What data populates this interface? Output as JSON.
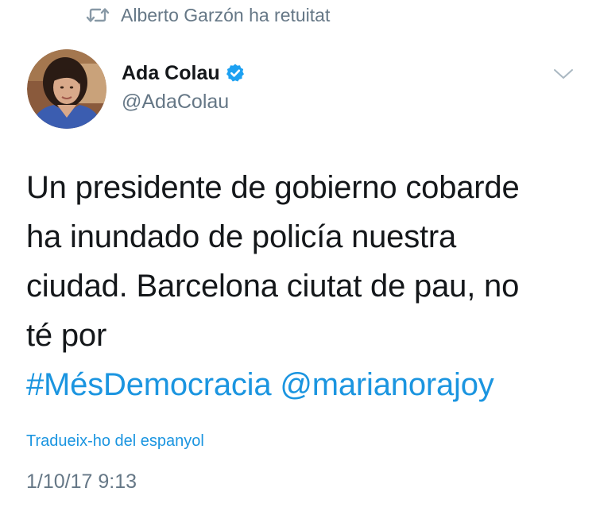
{
  "retweet": {
    "icon": "retweet-icon",
    "text": "Alberto Garzón ha retuitat"
  },
  "author": {
    "avatar": "avatar",
    "name": "Ada Colau",
    "verified_icon": "verified-badge-icon",
    "handle": "@AdaColau"
  },
  "menu": {
    "icon": "chevron-down-icon"
  },
  "tweet": {
    "lines": [
      "Un presidente de gobierno cobarde",
      "ha inundado de policía nuestra",
      "ciudad. Barcelona ciutat de pau, no",
      "té por"
    ],
    "hashtag": "#MésDemocracia",
    "mention": "@marianorajoy",
    "translate_label": "Tradueix-ho del espanyol",
    "timestamp": "1/10/17 9:13"
  },
  "colors": {
    "link": "#1b95e0",
    "secondary_text": "#657786",
    "primary_text": "#14171a",
    "verified": "#1da1f2"
  }
}
